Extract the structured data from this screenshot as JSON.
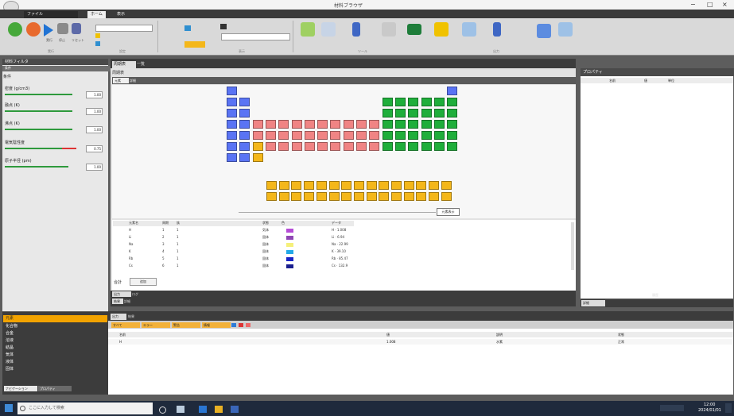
{
  "window": {
    "title": "材料ブラウザ",
    "minimize": "−",
    "maximize": "□",
    "close": "×"
  },
  "ribbon": {
    "tabs": [
      "ファイル",
      "ホーム",
      "表示"
    ],
    "active_tab": "ホーム",
    "groups": [
      "実行",
      "設定",
      "表示",
      "ツール",
      "出力"
    ],
    "buttons": [
      "実行",
      "停止",
      "リセット",
      "開く",
      "保存",
      "エクスポート",
      "比較",
      "グラフ",
      "レポート",
      "設定",
      "ヘルプ"
    ]
  },
  "left_panel": {
    "header": "材料フィルタ",
    "sub_header": "条件",
    "sliders": [
      {
        "label": "密度 (g/cm3)",
        "value": "1.00",
        "fill": 0.85
      },
      {
        "label": "融点 (K)",
        "value": "1.00",
        "fill": 0.85
      },
      {
        "label": "沸点 (K)",
        "value": "1.00",
        "fill": 0.85
      },
      {
        "label": "電気陰性度",
        "value": "0.75",
        "fill": 0.9
      },
      {
        "label": "原子半径 (pm)",
        "value": "1.00",
        "fill": 0.8
      }
    ],
    "nav_items": [
      "元素",
      "化合物",
      "合金",
      "溶液",
      "結晶",
      "気体",
      "液体",
      "固体"
    ],
    "bottom_tabs": [
      "ナビゲーション",
      "プロパティ"
    ]
  },
  "doc": {
    "tabs": [
      "周期表",
      "一覧"
    ],
    "active_tab": "周期表",
    "section": "周期表",
    "sub_tabs": [
      "元素",
      "詳細"
    ],
    "table_button": "元素表示",
    "columns": [
      "元素名",
      "周期",
      "族",
      "状態",
      "色",
      "データ"
    ],
    "rows": [
      {
        "name": "H",
        "period": "1",
        "group": "1",
        "state": "気体",
        "color": "#b54bd6",
        "data": "H · 1.008"
      },
      {
        "name": "Li",
        "period": "2",
        "group": "1",
        "state": "固体",
        "color": "#8f46b4",
        "data": "Li · 6.94"
      },
      {
        "name": "Na",
        "period": "3",
        "group": "1",
        "state": "固体",
        "color": "#f5f07a",
        "data": "Na · 22.99"
      },
      {
        "name": "K",
        "period": "4",
        "group": "1",
        "state": "固体",
        "color": "#23a9e8",
        "data": "K · 39.10"
      },
      {
        "name": "Rb",
        "period": "5",
        "group": "1",
        "state": "固体",
        "color": "#1a24c6",
        "data": "Rb · 85.47"
      },
      {
        "name": "Cs",
        "period": "6",
        "group": "1",
        "state": "固体",
        "color": "#1a1f8f",
        "data": "Cs · 132.9"
      }
    ],
    "footer_label": "合計",
    "footer_button": "追加",
    "bottom_tabs": [
      "出力",
      "ログ"
    ],
    "bottom_sub": [
      "結果",
      "詳細"
    ]
  },
  "right_panel": {
    "header": "プロパティ",
    "columns": [
      "名前",
      "値",
      "単位"
    ],
    "bottom_tab": "詳細",
    "bottom_tab2": "履歴"
  },
  "lower_panel": {
    "tabs": [
      "出力",
      "結果"
    ],
    "toolbar": [
      "すべて",
      "エラー",
      "警告",
      "情報"
    ],
    "columns": [
      "名前",
      "値",
      "説明",
      "状態"
    ],
    "rows": [
      [
        "H",
        "1.008",
        "水素",
        "正常"
      ]
    ]
  },
  "taskbar": {
    "search_placeholder": "ここに入力して検索",
    "time": "12:00",
    "date": "2024/01/01"
  }
}
